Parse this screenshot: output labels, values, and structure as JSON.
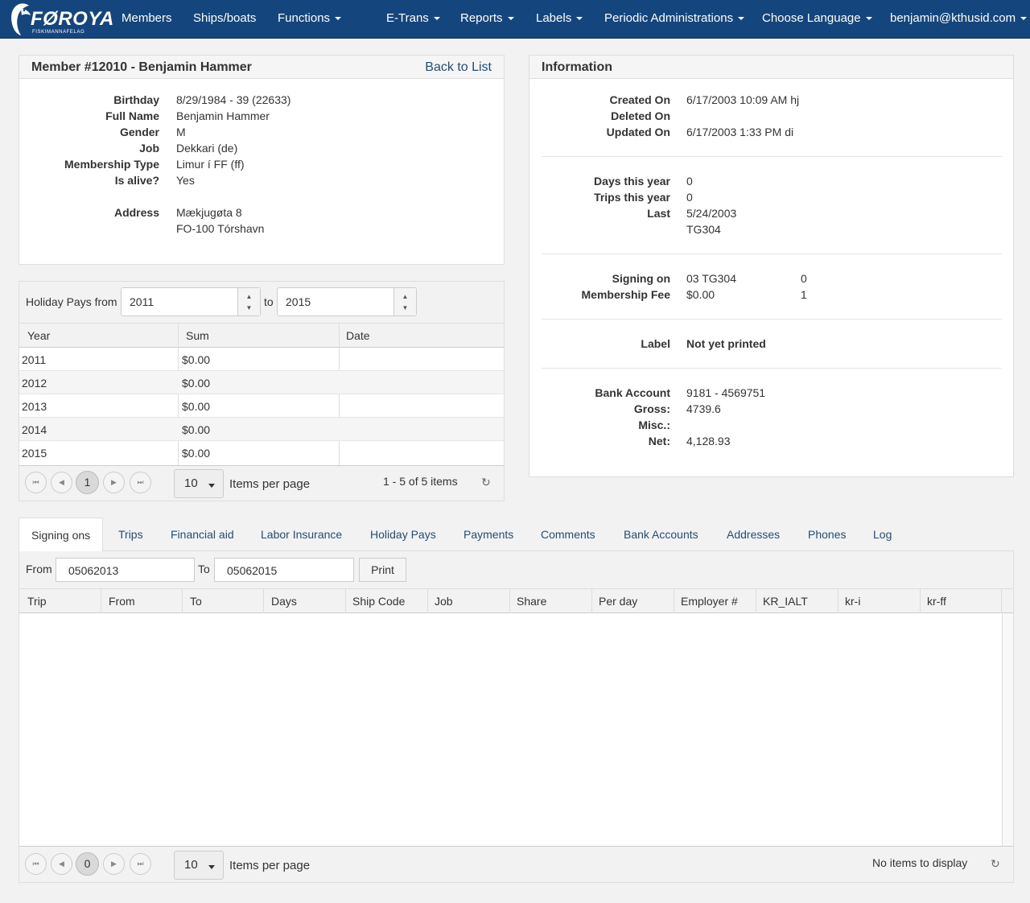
{
  "nav": {
    "brand": "FØROYA",
    "brand_sub": "FISKIMANNAFELAG",
    "items": [
      "Members",
      "Ships/boats",
      "Functions",
      "E-Trans",
      "Reports",
      "Labels",
      "Periodic Administrations",
      "Choose Language",
      "benjamin@kthusid.com"
    ]
  },
  "member": {
    "title": "Member #12010 - Benjamin Hammer",
    "back": "Back to List",
    "fields": [
      {
        "label": "Birthday",
        "value": "8/29/1984 - 39 (22633)"
      },
      {
        "label": "Full Name",
        "value": "Benjamin Hammer"
      },
      {
        "label": "Gender",
        "value": "M"
      },
      {
        "label": "Job",
        "value": "Dekkari (de)"
      },
      {
        "label": "Membership Type",
        "value": "Limur í FF (ff)"
      },
      {
        "label": "Is alive?",
        "value": "Yes"
      }
    ],
    "address_label": "Address",
    "address_lines": [
      "Mækjugøta 8",
      "FO-100 Tórshavn"
    ]
  },
  "holiday": {
    "from_label": "Holiday Pays from",
    "from_value": "2011",
    "to_label": "to",
    "to_value": "2015",
    "columns": [
      "Year",
      "Sum",
      "Date"
    ],
    "rows": [
      [
        "2011",
        "$0.00",
        ""
      ],
      [
        "2012",
        "$0.00",
        ""
      ],
      [
        "2013",
        "$0.00",
        ""
      ],
      [
        "2014",
        "$0.00",
        ""
      ],
      [
        "2015",
        "$0.00",
        ""
      ]
    ],
    "page": "1",
    "page_size": "10",
    "items_per_page": "Items per page",
    "summary": "1 - 5 of 5 items"
  },
  "info": {
    "title": "Information",
    "group1": [
      [
        "Created On",
        "6/17/2003 10:09 AM hj"
      ],
      [
        "Deleted On",
        ""
      ],
      [
        "Updated On",
        "6/17/2003 1:33 PM di"
      ]
    ],
    "group2": [
      [
        "Days this year",
        "0"
      ],
      [
        "Trips this year",
        "0"
      ],
      [
        "Last",
        "5/24/2003"
      ],
      [
        "",
        "TG304"
      ]
    ],
    "signing_label": "Signing on",
    "signing_value": "03 TG304",
    "signing_count": "0",
    "fee_label": "Membership Fee",
    "fee_value": "$0.00",
    "fee_count": "1",
    "label_label": "Label",
    "label_value": "Not yet printed",
    "group5": [
      [
        "Bank Account",
        "9181 - 4569751"
      ],
      [
        "Gross:",
        "4739.6"
      ],
      [
        "Misc.:",
        ""
      ],
      [
        "Net:",
        "4,128.93"
      ]
    ]
  },
  "tabs": [
    "Signing ons",
    "Trips",
    "Financial aid",
    "Labor Insurance",
    "Holiday Pays",
    "Payments",
    "Comments",
    "Bank Accounts",
    "Addresses",
    "Phones",
    "Log"
  ],
  "signing": {
    "from_label": "From",
    "from_value": "05062013",
    "to_label": "To",
    "to_value": "05062015",
    "print": "Print",
    "columns": [
      "Trip",
      "From",
      "To",
      "Days",
      "Ship Code",
      "Job",
      "Share",
      "Per day",
      "Employer #",
      "KR_IALT",
      "kr-i",
      "kr-ff"
    ],
    "page": "0",
    "page_size": "10",
    "items_per_page": "Items per page",
    "empty": "No items to display"
  }
}
